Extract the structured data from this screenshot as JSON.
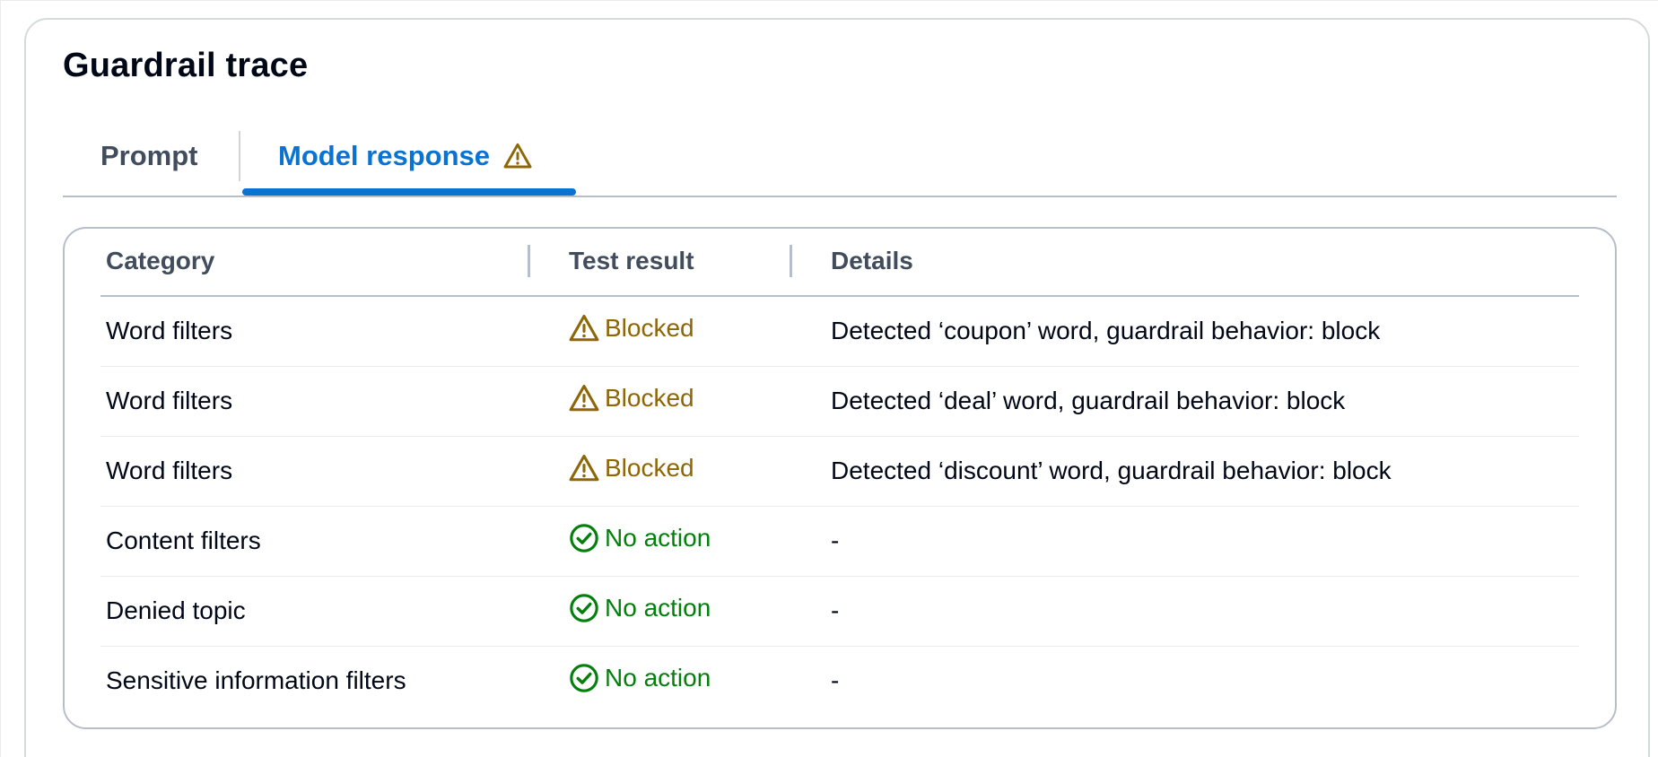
{
  "panel": {
    "title": "Guardrail trace"
  },
  "tabs": [
    {
      "label": "Prompt",
      "selected": false
    },
    {
      "label": "Model response",
      "selected": true,
      "icon": "warning-icon"
    }
  ],
  "table": {
    "columns": [
      "Category",
      "Test result",
      "Details"
    ],
    "rows": [
      {
        "category": "Word filters",
        "result": "Blocked",
        "result_icon": "warning-icon",
        "details": "Detected ‘coupon’ word, guardrail behavior: block"
      },
      {
        "category": "Word filters",
        "result": "Blocked",
        "result_icon": "warning-icon",
        "details": "Detected ‘deal’ word, guardrail behavior: block"
      },
      {
        "category": "Word filters",
        "result": "Blocked",
        "result_icon": "warning-icon",
        "details": "Detected ‘discount’ word, guardrail behavior: block"
      },
      {
        "category": "Content filters",
        "result": "No action",
        "result_icon": "check-circle-icon",
        "details": "-"
      },
      {
        "category": "Denied topic",
        "result": "No action",
        "result_icon": "check-circle-icon",
        "details": "-"
      },
      {
        "category": "Sensitive information filters",
        "result": "No action",
        "result_icon": "check-circle-icon",
        "details": "-"
      }
    ]
  },
  "colors": {
    "accent": "#0972d3",
    "warning": "#8d6605",
    "success": "#037f0c",
    "header_text": "#414d5c"
  }
}
